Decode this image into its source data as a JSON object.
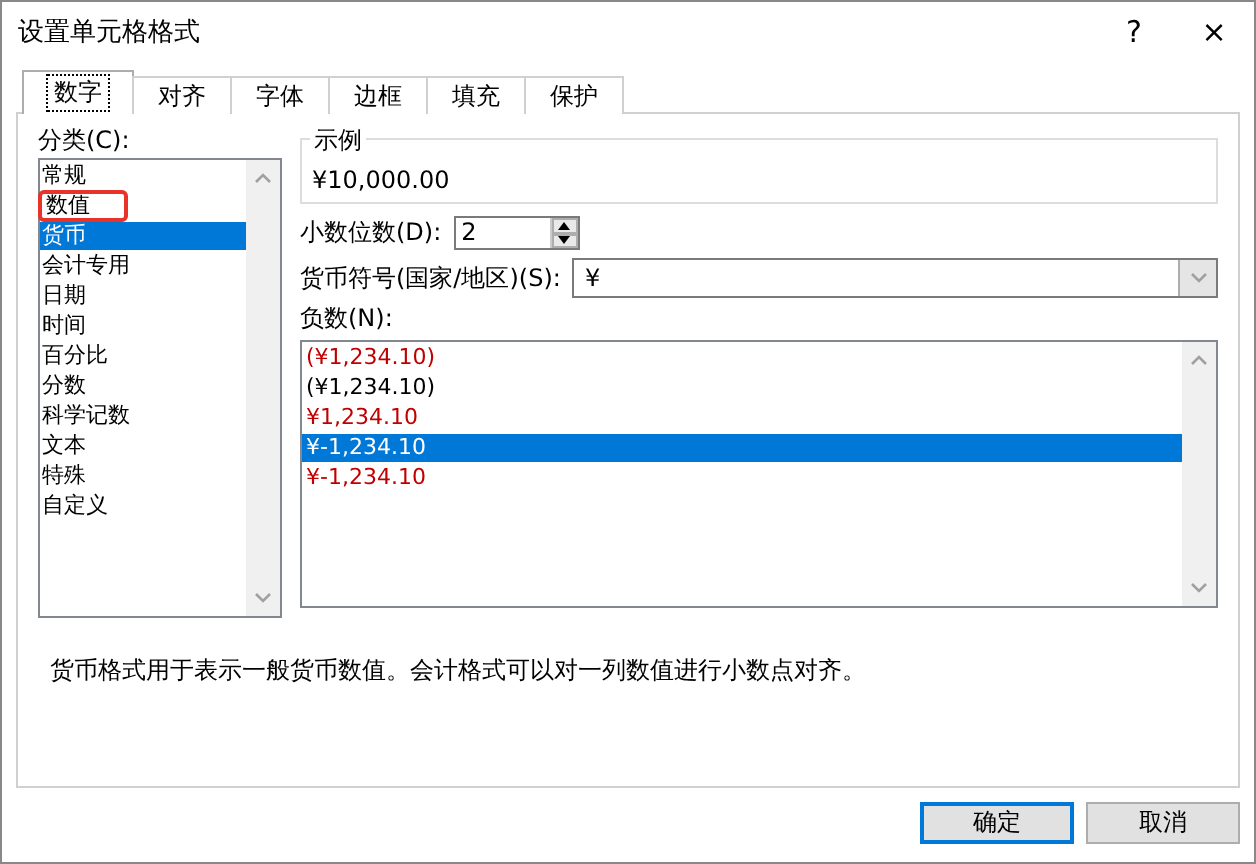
{
  "window": {
    "title": "设置单元格格式",
    "help_button": "?",
    "close_button": "×"
  },
  "tabs": [
    {
      "label": "数字",
      "selected": true
    },
    {
      "label": "对齐",
      "selected": false
    },
    {
      "label": "字体",
      "selected": false
    },
    {
      "label": "边框",
      "selected": false
    },
    {
      "label": "填充",
      "selected": false
    },
    {
      "label": "保护",
      "selected": false
    }
  ],
  "category": {
    "label": "分类(C):",
    "items": [
      {
        "label": "常规",
        "selected": false,
        "highlighted": false
      },
      {
        "label": "数值",
        "selected": false,
        "highlighted": true
      },
      {
        "label": "货币",
        "selected": true,
        "highlighted": false
      },
      {
        "label": "会计专用",
        "selected": false,
        "highlighted": false
      },
      {
        "label": "日期",
        "selected": false,
        "highlighted": false
      },
      {
        "label": "时间",
        "selected": false,
        "highlighted": false
      },
      {
        "label": "百分比",
        "selected": false,
        "highlighted": false
      },
      {
        "label": "分数",
        "selected": false,
        "highlighted": false
      },
      {
        "label": "科学记数",
        "selected": false,
        "highlighted": false
      },
      {
        "label": "文本",
        "selected": false,
        "highlighted": false
      },
      {
        "label": "特殊",
        "selected": false,
        "highlighted": false
      },
      {
        "label": "自定义",
        "selected": false,
        "highlighted": false
      }
    ]
  },
  "sample": {
    "label": "示例",
    "value": "¥10,000.00"
  },
  "decimal_places": {
    "label": "小数位数(D):",
    "value": "2"
  },
  "currency_symbol": {
    "label": "货币符号(国家/地区)(S):",
    "value": "¥"
  },
  "negative_numbers": {
    "label": "负数(N):",
    "items": [
      {
        "label": "(¥1,234.10)",
        "color": "#c00000",
        "selected": false
      },
      {
        "label": "(¥1,234.10)",
        "color": "#000000",
        "selected": false
      },
      {
        "label": "¥1,234.10",
        "color": "#c00000",
        "selected": false
      },
      {
        "label": "¥-1,234.10",
        "selected": true
      },
      {
        "label": "¥-1,234.10",
        "color": "#c00000",
        "selected": false
      }
    ]
  },
  "description": "货币格式用于表示一般货币数值。会计格式可以对一列数值进行小数点对齐。",
  "buttons": [
    {
      "label": "确定",
      "default": true
    },
    {
      "label": "取消",
      "default": false
    }
  ]
}
